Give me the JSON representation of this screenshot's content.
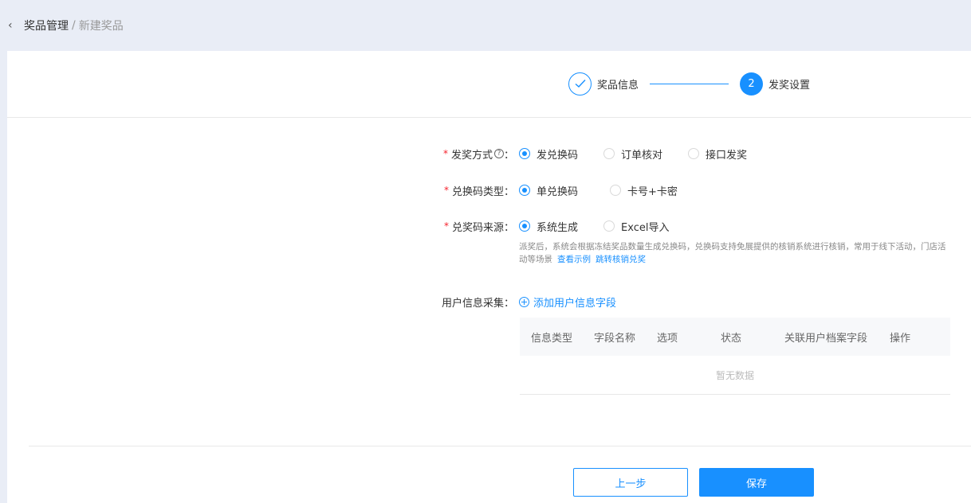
{
  "breadcrumb": {
    "back_icon": "‹",
    "root": "奖品管理",
    "separator": "/",
    "current": "新建奖品"
  },
  "steps": [
    {
      "index": "✓",
      "label": "奖品信息",
      "state": "done"
    },
    {
      "index": "2",
      "label": "发奖设置",
      "state": "active"
    }
  ],
  "form": {
    "award_method": {
      "required": "*",
      "label": "发奖方式",
      "help_icon": "?",
      "colon": "：",
      "options": [
        "发兑换码",
        "订单核对",
        "接口发奖"
      ],
      "selected": 0
    },
    "code_type": {
      "required": "*",
      "label": "兑换码类型：",
      "options": [
        "单兑换码",
        "卡号+卡密"
      ],
      "selected": 0
    },
    "code_source": {
      "required": "*",
      "label": "兑奖码来源：",
      "options": [
        "系统生成",
        "Excel导入"
      ],
      "selected": 0,
      "description": "派奖后，系统会根据冻结奖品数量生成兑换码，兑换码支持免展提供的核销系统进行核销，常用于线下活动，门店活动等场景",
      "link_example": "查看示例",
      "link_redeem": "跳转核销兑奖"
    },
    "user_info": {
      "label": "用户信息采集：",
      "add_label": "添加用户信息字段"
    }
  },
  "table": {
    "headers": [
      "信息类型",
      "字段名称",
      "选项",
      "状态",
      "关联用户档案字段",
      "操作"
    ],
    "empty_text": "暂无数据"
  },
  "buttons": {
    "prev": "上一步",
    "save": "保存"
  },
  "colors": {
    "primary": "#1890ff",
    "required": "#f5222d",
    "background": "#e9edf6"
  }
}
